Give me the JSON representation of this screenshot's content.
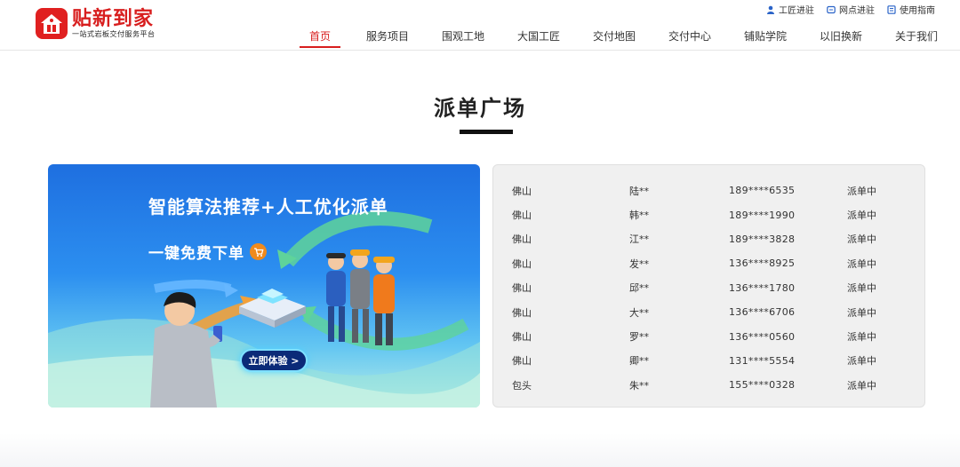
{
  "brand": {
    "name": "贴新到家",
    "tagline": "一站式岩板交付服务平台",
    "accent": "#d81e1e"
  },
  "top_links": [
    {
      "label": "工匠进驻",
      "icon": "person-icon"
    },
    {
      "label": "网点进驻",
      "icon": "store-icon"
    },
    {
      "label": "使用指南",
      "icon": "guide-icon"
    }
  ],
  "nav": {
    "active_index": 0,
    "items": [
      "首页",
      "服务项目",
      "围观工地",
      "大国工匠",
      "交付地图",
      "交付中心",
      "铺贴学院",
      "以旧换新",
      "关于我们"
    ]
  },
  "section": {
    "title": "派单广场"
  },
  "banner": {
    "headline": "智能算法推荐+人工优化派单",
    "subline": "一键免费下单",
    "cta": "立即体验 >"
  },
  "orders": [
    {
      "city": "佛山",
      "name": "陆**",
      "phone": "189****6535",
      "status": "派单中"
    },
    {
      "city": "佛山",
      "name": "韩**",
      "phone": "189****1990",
      "status": "派单中"
    },
    {
      "city": "佛山",
      "name": "江**",
      "phone": "189****3828",
      "status": "派单中"
    },
    {
      "city": "佛山",
      "name": "发**",
      "phone": "136****8925",
      "status": "派单中"
    },
    {
      "city": "佛山",
      "name": "邱**",
      "phone": "136****1780",
      "status": "派单中"
    },
    {
      "city": "佛山",
      "name": "大**",
      "phone": "136****6706",
      "status": "派单中"
    },
    {
      "city": "佛山",
      "name": "罗**",
      "phone": "136****0560",
      "status": "派单中"
    },
    {
      "city": "佛山",
      "name": "卿**",
      "phone": "131****5554",
      "status": "派单中"
    },
    {
      "city": "包头",
      "name": "朱**",
      "phone": "155****0328",
      "status": "派单中"
    }
  ]
}
